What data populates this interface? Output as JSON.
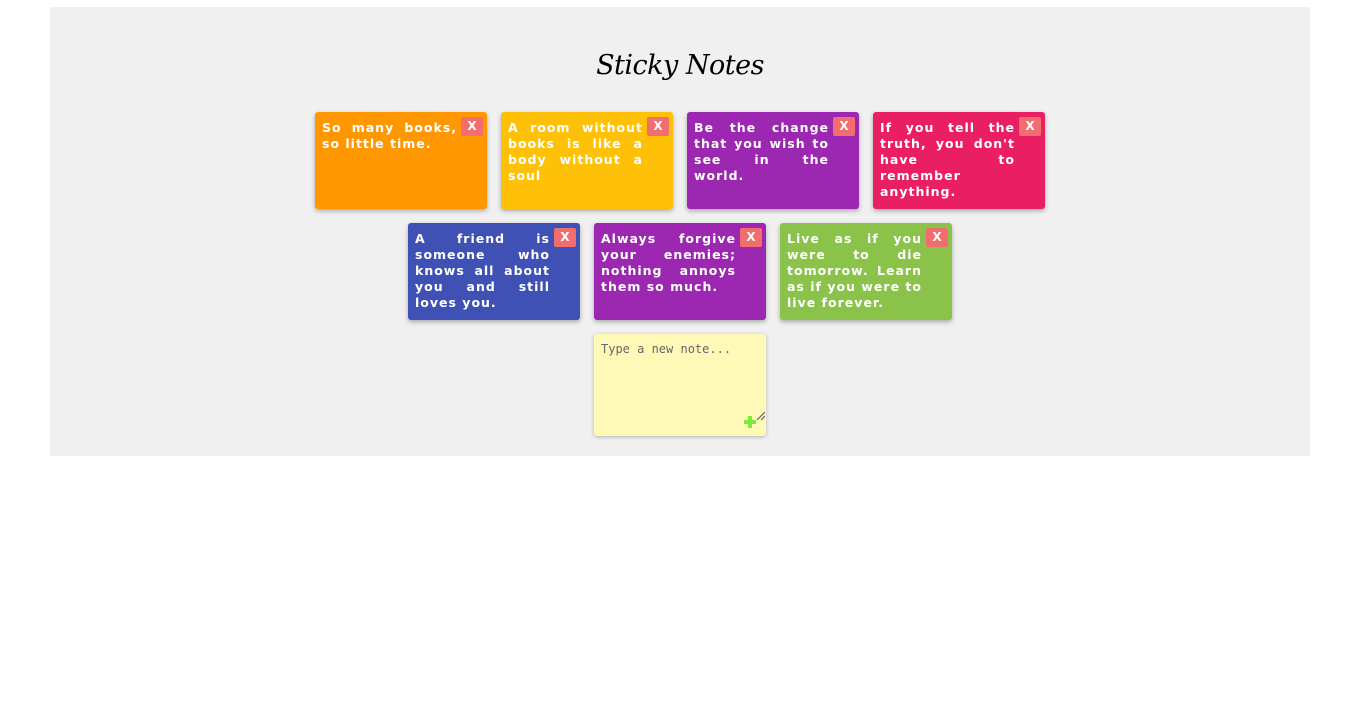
{
  "header": {
    "title": "Sticky Notes"
  },
  "notes_row1": [
    {
      "text": "So many books, so little time.",
      "color": "#ff9800",
      "close_label": "X"
    },
    {
      "text": "A room without books is like a body without a soul",
      "color": "#ffc107",
      "close_label": "X"
    },
    {
      "text": "Be the change that you wish to see in the world.",
      "color": "#9c27b0",
      "close_label": "X"
    },
    {
      "text": "If you tell the truth, you don't have to remember anything.",
      "color": "#e91e63",
      "close_label": "X"
    }
  ],
  "notes_row2": [
    {
      "text": "A friend is someone who knows all about you and still loves you.",
      "color": "#3f51b5",
      "close_label": "X"
    },
    {
      "text": "Always forgive your enemies; nothing annoys them so much.",
      "color": "#9c27b0",
      "close_label": "X"
    },
    {
      "text": "Live as if you were to die tomorrow. Learn as if you were to live forever.",
      "color": "#8bc34a",
      "close_label": "X"
    }
  ],
  "new_note": {
    "placeholder": "Type a new note...",
    "value": "",
    "add_icon": "plus-icon",
    "color": "#fff9b8"
  },
  "colors": {
    "board_background": "#f0f0f0",
    "close_button": "#f26d6d",
    "add_icon": "#7bea3d"
  }
}
